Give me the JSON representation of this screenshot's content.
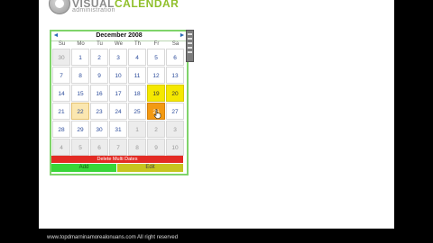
{
  "app": {
    "logo_main": "VISUAL",
    "logo_accent": "CALENDAR",
    "logo_sub": "administration"
  },
  "calendar": {
    "month_label": "December 2008",
    "prev_label": "◄",
    "next_label": "►",
    "weekdays": [
      "Su",
      "Mo",
      "Tu",
      "We",
      "Th",
      "Fr",
      "Sa"
    ],
    "weeks": [
      [
        "30",
        "1",
        "2",
        "3",
        "4",
        "5",
        "6"
      ],
      [
        "7",
        "8",
        "9",
        "10",
        "11",
        "12",
        "13"
      ],
      [
        "14",
        "15",
        "16",
        "17",
        "18",
        "19",
        "20"
      ],
      [
        "21",
        "22",
        "23",
        "24",
        "25",
        "26",
        "27"
      ],
      [
        "28",
        "29",
        "30",
        "31",
        "1",
        "2",
        "3"
      ],
      [
        "4",
        "5",
        "6",
        "7",
        "8",
        "9",
        "10"
      ]
    ],
    "delete_label": "Delete Multi Dates",
    "add_label": "Add",
    "edit_label": "Edit"
  },
  "colors": {
    "event_yellow": "#f5e800",
    "event_orange": "#f39a12",
    "delete_bar": "#e32b24",
    "add_button": "#38d638",
    "edit_button": "#c7c51f",
    "calendar_border": "#7fd46a"
  },
  "footer": {
    "copyright": "www.topdmarninamorealonuans.com All right reserved"
  }
}
